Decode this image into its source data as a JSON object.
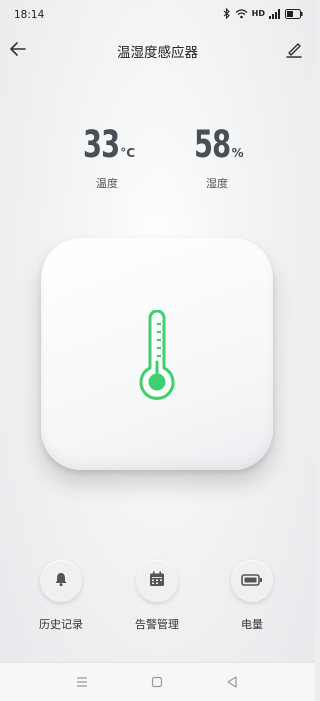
{
  "status_bar": {
    "time": "18:14",
    "network_label": "HD",
    "icons": [
      "bluetooth-icon",
      "wifi-icon",
      "signal-icon",
      "battery-icon"
    ]
  },
  "header": {
    "title": "温湿度感应器",
    "back_icon": "arrow-left-icon",
    "edit_icon": "pencil-icon"
  },
  "readings": {
    "temperature": {
      "value": "33",
      "unit": "°C",
      "label": "温度"
    },
    "humidity": {
      "value": "58",
      "unit": "%",
      "label": "湿度"
    }
  },
  "device": {
    "icon": "thermometer-icon",
    "accent": "#3fcf6f"
  },
  "actions": [
    {
      "label": "历史记录",
      "icon": "bell-icon"
    },
    {
      "label": "告警管理",
      "icon": "calendar-icon"
    },
    {
      "label": "电量",
      "icon": "battery-icon"
    }
  ],
  "navbar": {
    "icons": [
      "menu-icon",
      "home-square-icon",
      "back-triangle-icon"
    ]
  },
  "colors": {
    "text_primary": "#222222",
    "reading_text": "#4a4f55",
    "background": "#eceef0"
  }
}
